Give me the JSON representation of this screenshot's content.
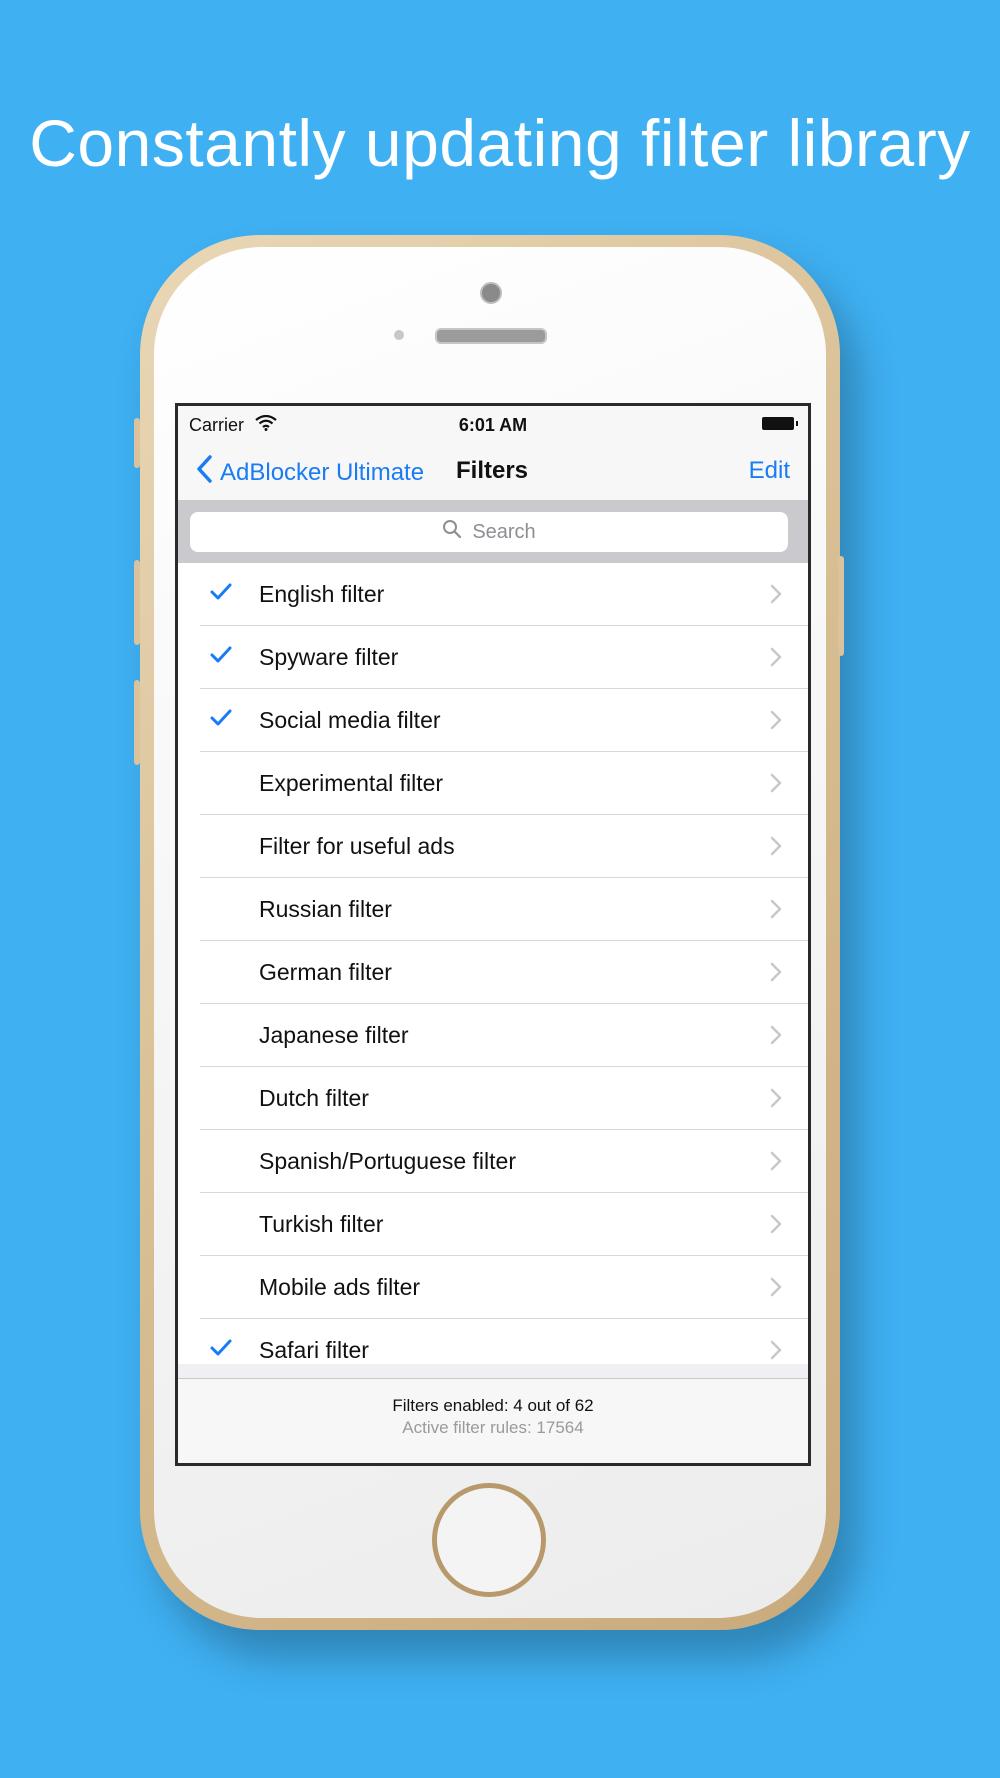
{
  "headline": "Constantly updating filter library",
  "colors": {
    "background": "#3fb0f2",
    "accent": "#1a7cf4",
    "phone_frame": "#d7bd92"
  },
  "status_bar": {
    "carrier": "Carrier",
    "time": "6:01 AM",
    "wifi_icon": "wifi-icon",
    "battery_icon": "battery-icon"
  },
  "nav": {
    "back_label": "AdBlocker Ultimate",
    "title": "Filters",
    "edit_label": "Edit"
  },
  "search": {
    "placeholder": "Search"
  },
  "filters": [
    {
      "label": "English filter",
      "checked": true
    },
    {
      "label": "Spyware filter",
      "checked": true
    },
    {
      "label": "Social media filter",
      "checked": true
    },
    {
      "label": "Experimental filter",
      "checked": false
    },
    {
      "label": "Filter for useful ads",
      "checked": false
    },
    {
      "label": "Russian filter",
      "checked": false
    },
    {
      "label": "German filter",
      "checked": false
    },
    {
      "label": "Japanese filter",
      "checked": false
    },
    {
      "label": "Dutch filter",
      "checked": false
    },
    {
      "label": "Spanish/Portuguese filter",
      "checked": false
    },
    {
      "label": "Turkish filter",
      "checked": false
    },
    {
      "label": "Mobile ads filter",
      "checked": false
    },
    {
      "label": "Safari filter",
      "checked": true
    }
  ],
  "footer": {
    "enabled": "Filters enabled: 4 out of 62",
    "rules": "Active filter rules: 17564"
  }
}
